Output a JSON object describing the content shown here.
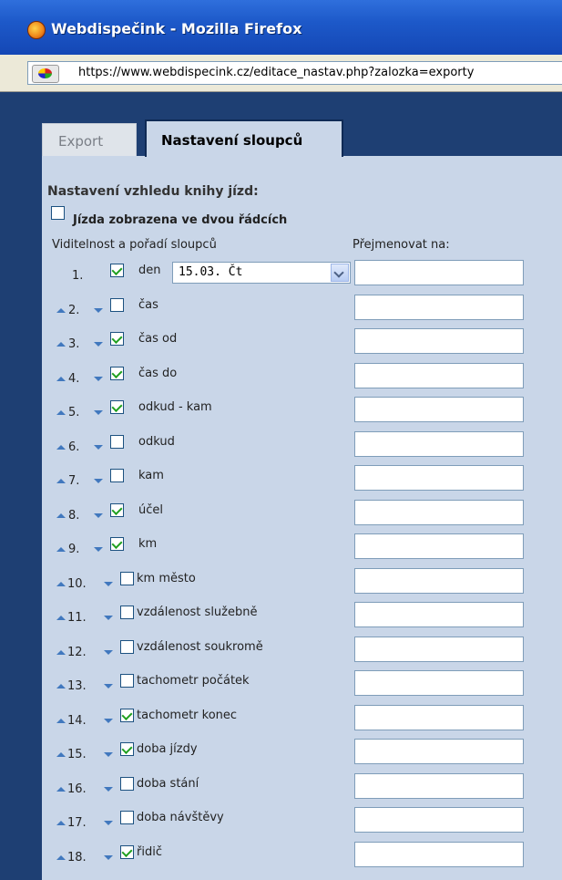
{
  "window": {
    "title": "Webdispečink - Mozilla Firefox"
  },
  "address_bar": {
    "url": "https://www.webdispecink.cz/editace_nastav.php?zalozka=exporty"
  },
  "tabs": [
    {
      "label": "Export",
      "active": false
    },
    {
      "label": "Nastavení sloupců",
      "active": true
    }
  ],
  "section": {
    "title": "Nastavení vzhledu knihy jízd:",
    "two_rows_label": "Jízda zobrazena ve dvou řádcích",
    "two_rows_checked": false
  },
  "columns_header": {
    "visibility": "Viditelnost a pořadí sloupců",
    "rename": "Přejmenovat na:"
  },
  "date_select": {
    "value": "15.03. Čt"
  },
  "rows": [
    {
      "num": "1.",
      "label": "den",
      "checked": true
    },
    {
      "num": "2.",
      "label": "čas",
      "checked": false
    },
    {
      "num": "3.",
      "label": "čas od",
      "checked": true
    },
    {
      "num": "4.",
      "label": "čas do",
      "checked": true
    },
    {
      "num": "5.",
      "label": "odkud - kam",
      "checked": true
    },
    {
      "num": "6.",
      "label": "odkud",
      "checked": false
    },
    {
      "num": "7.",
      "label": "kam",
      "checked": false
    },
    {
      "num": "8.",
      "label": "účel",
      "checked": true
    },
    {
      "num": "9.",
      "label": "km",
      "checked": true
    },
    {
      "num": "10.",
      "label": "km město",
      "checked": false
    },
    {
      "num": "11.",
      "label": "vzdálenost služebně",
      "checked": false
    },
    {
      "num": "12.",
      "label": "vzdálenost soukromě",
      "checked": false
    },
    {
      "num": "13.",
      "label": "tachometr počátek",
      "checked": false
    },
    {
      "num": "14.",
      "label": "tachometr konec",
      "checked": true
    },
    {
      "num": "15.",
      "label": "doba jízdy",
      "checked": true
    },
    {
      "num": "16.",
      "label": "doba stání",
      "checked": false
    },
    {
      "num": "17.",
      "label": "doba návštěvy",
      "checked": false
    },
    {
      "num": "18.",
      "label": "řidič",
      "checked": true
    }
  ]
}
